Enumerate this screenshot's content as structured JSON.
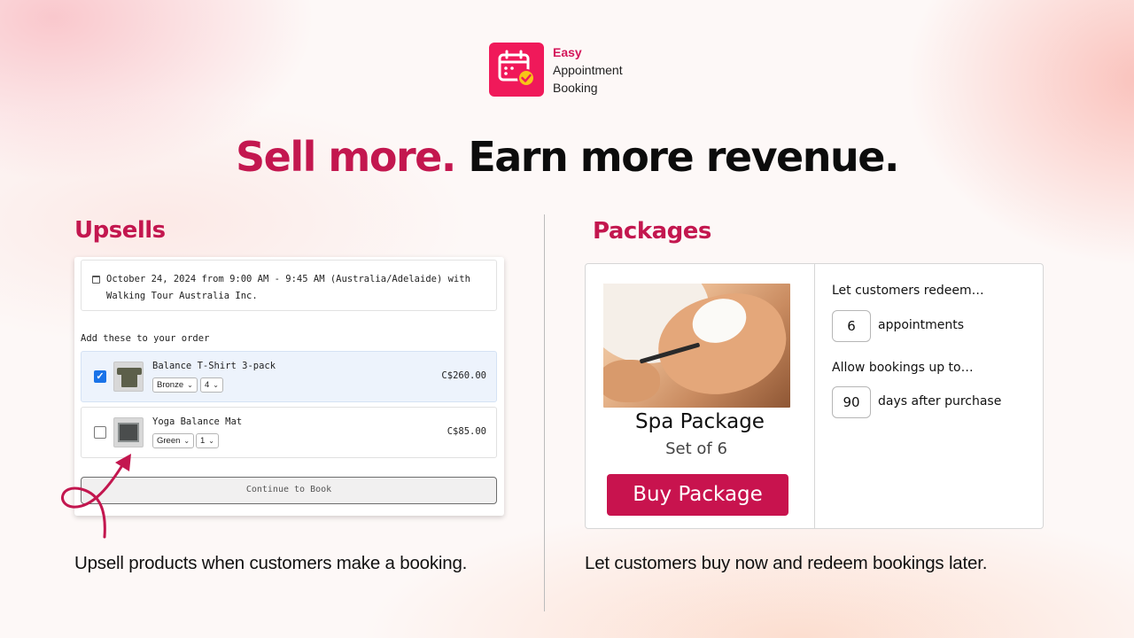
{
  "brand": {
    "line1": "Easy",
    "line2": "Appointment",
    "line3": "Booking",
    "colors": {
      "accent": "#c3174f",
      "logo_bg": "#f0195a",
      "logo_badge": "#f7c418"
    },
    "icon": "calendar-check-icon"
  },
  "headline": {
    "accent": "Sell more.",
    "main": "Earn more revenue."
  },
  "upsells": {
    "title": "Upsells",
    "booking_text": "October 24, 2024 from 9:00 AM - 9:45 AM (Australia/Adelaide) with Walking Tour Australia Inc.",
    "add_label": "Add these to your order",
    "items": [
      {
        "name": "Balance T-Shirt 3-pack",
        "variant": "Bronze",
        "qty": "4",
        "price": "C$260.00",
        "checked": true
      },
      {
        "name": "Yoga Balance Mat",
        "variant": "Green",
        "qty": "1",
        "price": "C$85.00",
        "checked": false
      }
    ],
    "continue_label": "Continue to Book",
    "caption": "Upsell products when customers make a booking."
  },
  "packages": {
    "title": "Packages",
    "name": "Spa Package",
    "subtitle": "Set of 6",
    "buy_label": "Buy Package",
    "redeem_label": "Let customers redeem…",
    "redeem_count": "6",
    "redeem_unit": "appointments",
    "window_label": "Allow bookings up to…",
    "window_days": "90",
    "window_unit": "days after purchase",
    "caption": "Let customers buy now and redeem bookings later."
  }
}
